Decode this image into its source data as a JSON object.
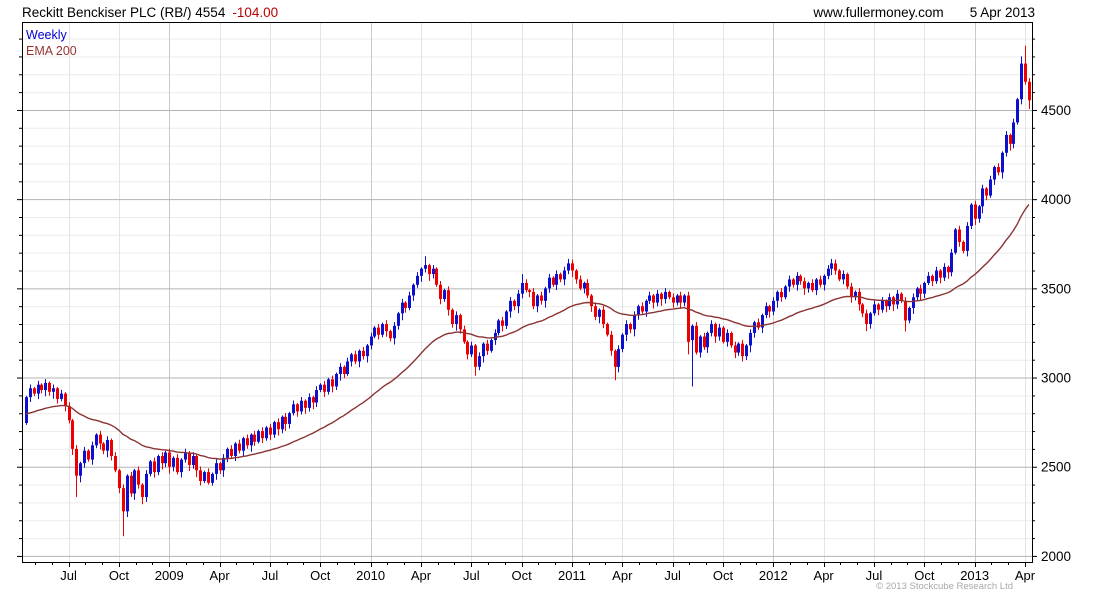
{
  "header": {
    "title": "Reckitt Benckiser PLC (RB/) 4554",
    "change": "-104.00",
    "site": "www.fullermoney.com",
    "date": "5 Apr 2013"
  },
  "legend": {
    "series_label": "Weekly",
    "ema_label": "EMA 200"
  },
  "footer": {
    "copyright": "© 2013 Stockcube Research Ltd"
  },
  "colors": {
    "up_candle": "#0f0fd0",
    "down_candle": "#ee0000",
    "ema_line": "#8b3333",
    "title_text": "#000000",
    "change_text": "#bb0000",
    "legend_weekly": "#0000cc",
    "legend_ema": "#993333",
    "grid_minor": "#ececec",
    "grid_quarter": "#e4e4e4",
    "grid_year": "#c9c9c9",
    "grid_major_h": "#b3b3b3",
    "axis_border": "#000000",
    "copyright_text": "#a8a8a8"
  },
  "chart_data": {
    "type": "candlestick",
    "title": "Reckitt Benckiser PLC (RB/)",
    "interval": "weekly",
    "last_price": 4554,
    "change": -104.0,
    "date_label": "5 Apr 2013",
    "overlay": {
      "name": "EMA 200",
      "period_weeks": 40,
      "seed": 2790
    },
    "x_axis": {
      "weeks_total": 260,
      "month_tick_start_week": 2.33,
      "month_tick_step_weeks": 4.333,
      "ticks": [
        {
          "label": "Jul",
          "week": 11
        },
        {
          "label": "Oct",
          "week": 24
        },
        {
          "label": "2009",
          "week": 37
        },
        {
          "label": "Apr",
          "week": 50
        },
        {
          "label": "Jul",
          "week": 63
        },
        {
          "label": "Oct",
          "week": 76
        },
        {
          "label": "2010",
          "week": 89
        },
        {
          "label": "Apr",
          "week": 102
        },
        {
          "label": "Jul",
          "week": 115
        },
        {
          "label": "Oct",
          "week": 128
        },
        {
          "label": "2011",
          "week": 141
        },
        {
          "label": "Apr",
          "week": 154
        },
        {
          "label": "Jul",
          "week": 167
        },
        {
          "label": "Oct",
          "week": 180
        },
        {
          "label": "2012",
          "week": 193
        },
        {
          "label": "Apr",
          "week": 206
        },
        {
          "label": "Jul",
          "week": 219
        },
        {
          "label": "Oct",
          "week": 232
        },
        {
          "label": "2013",
          "week": 245
        },
        {
          "label": "Apr",
          "week": 258
        }
      ]
    },
    "y_axis": {
      "tick_labels": [
        2000,
        2500,
        3000,
        3500,
        4000,
        4500
      ],
      "major_step": 500,
      "minor_step": 100,
      "price_top": 4993,
      "price_bottom": 1966
    },
    "first_open": 2745,
    "weekly_closes": [
      2890,
      2940,
      2910,
      2960,
      2930,
      2970,
      2920,
      2940,
      2880,
      2910,
      2840,
      2760,
      2600,
      2450,
      2520,
      2590,
      2540,
      2620,
      2680,
      2630,
      2590,
      2650,
      2560,
      2480,
      2380,
      2250,
      2450,
      2350,
      2480,
      2400,
      2330,
      2460,
      2530,
      2470,
      2560,
      2520,
      2580,
      2500,
      2550,
      2470,
      2540,
      2580,
      2510,
      2560,
      2480,
      2420,
      2470,
      2410,
      2460,
      2520,
      2480,
      2550,
      2600,
      2560,
      2630,
      2590,
      2660,
      2620,
      2680,
      2640,
      2700,
      2660,
      2720,
      2680,
      2750,
      2710,
      2780,
      2740,
      2800,
      2850,
      2810,
      2870,
      2830,
      2890,
      2860,
      2930,
      2960,
      2920,
      2990,
      2950,
      3020,
      3060,
      3020,
      3090,
      3130,
      3090,
      3150,
      3120,
      3180,
      3230,
      3280,
      3240,
      3300,
      3260,
      3220,
      3290,
      3360,
      3420,
      3390,
      3460,
      3520,
      3570,
      3610,
      3630,
      3580,
      3610,
      3520,
      3440,
      3490,
      3380,
      3300,
      3350,
      3270,
      3200,
      3130,
      3180,
      3060,
      3120,
      3190,
      3150,
      3210,
      3250,
      3320,
      3290,
      3370,
      3430,
      3400,
      3470,
      3530,
      3490,
      3480,
      3400,
      3460,
      3430,
      3500,
      3560,
      3520,
      3580,
      3550,
      3600,
      3640,
      3600,
      3550,
      3500,
      3530,
      3460,
      3400,
      3340,
      3380,
      3300,
      3240,
      3150,
      3060,
      3160,
      3240,
      3300,
      3270,
      3350,
      3400,
      3370,
      3430,
      3460,
      3420,
      3470,
      3440,
      3480,
      3450,
      3420,
      3460,
      3420,
      3460,
      3200,
      3290,
      3140,
      3230,
      3170,
      3250,
      3300,
      3230,
      3280,
      3200,
      3250,
      3180,
      3140,
      3190,
      3120,
      3180,
      3250,
      3310,
      3280,
      3350,
      3400,
      3370,
      3430,
      3480,
      3450,
      3510,
      3550,
      3520,
      3570,
      3540,
      3500,
      3530,
      3490,
      3550,
      3520,
      3570,
      3610,
      3640,
      3600,
      3550,
      3580,
      3510,
      3450,
      3480,
      3410,
      3360,
      3300,
      3360,
      3410,
      3380,
      3430,
      3400,
      3450,
      3410,
      3470,
      3430,
      3320,
      3390,
      3450,
      3500,
      3470,
      3530,
      3570,
      3540,
      3600,
      3560,
      3620,
      3590,
      3700,
      3830,
      3760,
      3710,
      3850,
      3970,
      3890,
      3960,
      4060,
      4020,
      4110,
      4180,
      4150,
      4260,
      4360,
      4310,
      4430,
      4560,
      4760,
      4658,
      4554
    ],
    "overrides": [
      {
        "i": 13,
        "low": 2330
      },
      {
        "i": 25,
        "low": 2110
      },
      {
        "i": 30,
        "low": 2290
      },
      {
        "i": 47,
        "low": 2400
      },
      {
        "i": 103,
        "high": 3680
      },
      {
        "i": 116,
        "low": 3010
      },
      {
        "i": 128,
        "high": 3580
      },
      {
        "i": 140,
        "high": 3665
      },
      {
        "i": 152,
        "low": 2985
      },
      {
        "i": 171,
        "low": 3130
      },
      {
        "i": 172,
        "open": 3210,
        "low": 2950
      },
      {
        "i": 185,
        "low": 3090
      },
      {
        "i": 208,
        "high": 3665
      },
      {
        "i": 217,
        "low": 3260
      },
      {
        "i": 227,
        "low": 3258
      },
      {
        "i": 257,
        "high": 4800
      },
      {
        "i": 258,
        "high": 4860
      },
      {
        "i": 259,
        "low": 4505
      }
    ]
  }
}
